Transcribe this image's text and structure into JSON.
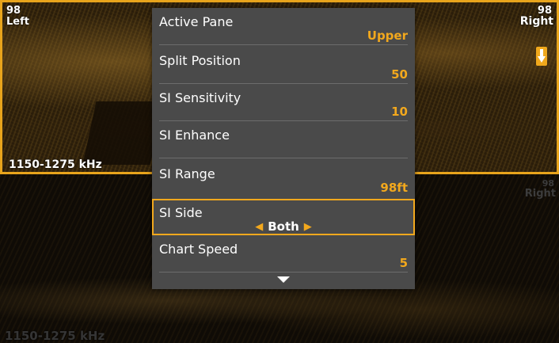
{
  "upper_pane": {
    "left_depth": "98",
    "left_side": "Left",
    "right_depth": "98",
    "right_side": "Right",
    "frequency": "1150-1275 kHz"
  },
  "lower_pane": {
    "right_depth": "98",
    "right_side": "Right",
    "frequency": "1150-1275 kHz"
  },
  "colors": {
    "accent": "#f2a81d",
    "menu_bg": "#4a4a4a",
    "pane_border": "#e8a41c"
  },
  "menu": {
    "items": [
      {
        "label": "Active Pane",
        "value": "Upper"
      },
      {
        "label": "Split Position",
        "value": "50"
      },
      {
        "label": "SI Sensitivity",
        "value": "10"
      },
      {
        "label": "SI Enhance",
        "value": ""
      },
      {
        "label": "SI Range",
        "value": "98ft"
      },
      {
        "label": "SI Side",
        "value": "Both",
        "selected": true
      },
      {
        "label": "Chart Speed",
        "value": "5"
      }
    ],
    "more_icon": "chevron-down-icon"
  }
}
